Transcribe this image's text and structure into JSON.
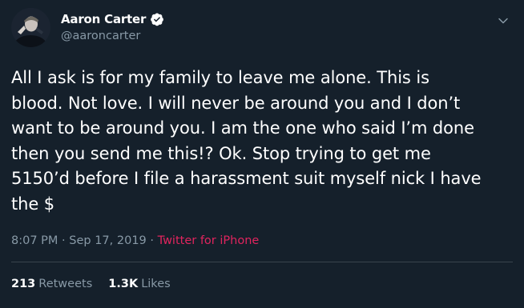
{
  "user": {
    "name": "Aaron Carter",
    "handle": "@aaroncarter",
    "avatar_icon": "profile-photo",
    "verified_icon": "verified-badge-icon"
  },
  "tweet": {
    "text": "All I ask is for my family to leave me alone. This is\nblood. Not love. I will never be around you and I don’t\nwant to be around you. I am the one who said I’m done\nthen you send me this!? Ok. Stop trying to get me\n5150’d before I file a harassment suit myself nick I have\nthe $",
    "time": "8:07 PM",
    "separator": " · ",
    "date": "Sep 17, 2019",
    "source": "Twitter for iPhone"
  },
  "stats": {
    "retweets_count": "213",
    "retweets_label": "Retweets",
    "likes_count": "1.3K",
    "likes_label": "Likes"
  },
  "colors": {
    "background": "#15202b",
    "primary_text": "#ffffff",
    "secondary_text": "#8899a6",
    "source_link": "#e0245e",
    "verified": "#ffffff",
    "divider": "#38444d"
  },
  "icons": {
    "more_menu": "chevron-down-icon"
  }
}
